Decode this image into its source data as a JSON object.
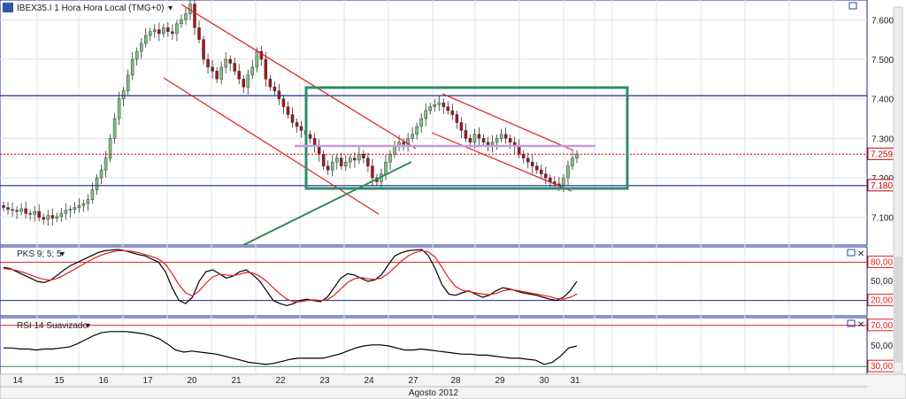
{
  "header": {
    "title": "IBEX35.I 1 Hora Hora Local (TMG+0)"
  },
  "colors": {
    "up_candle": "#7fc47f",
    "down_candle": "#b0101a",
    "channel": "#e02020",
    "support": "#2e8b57",
    "box": "#2e8b6e",
    "hline_blue": "#1c2a8c",
    "resistance": "#c49bdf",
    "price_dotted": "#c00000",
    "osc_black": "#000000",
    "osc_red": "#e02020"
  },
  "chart_data": [
    {
      "type": "candlestick",
      "name_label": "IBEX35.I",
      "ylim": [
        7030,
        7650
      ],
      "yticks": [
        "7.600,0",
        "7.500,0",
        "7.400,0",
        "7.300,0",
        "7.200,0",
        "7.100,0"
      ],
      "ytick_values": [
        7600,
        7500,
        7400,
        7300,
        7200,
        7100
      ],
      "price_labels": [
        {
          "text": "7.259,9",
          "value": 7259.9
        },
        {
          "text": "7.180,4",
          "value": 7180.4
        }
      ],
      "hlines": [
        7408,
        7180.4
      ],
      "dotted_price": 7259.9,
      "closes": [
        7125,
        7120,
        7118,
        7115,
        7122,
        7110,
        7108,
        7115,
        7100,
        7095,
        7105,
        7098,
        7102,
        7110,
        7118,
        7120,
        7125,
        7130,
        7135,
        7145,
        7170,
        7200,
        7220,
        7250,
        7300,
        7350,
        7400,
        7420,
        7460,
        7500,
        7520,
        7540,
        7560,
        7570,
        7575,
        7565,
        7580,
        7570,
        7565,
        7590,
        7600,
        7615,
        7640,
        7580,
        7550,
        7500,
        7480,
        7470,
        7450,
        7480,
        7500,
        7490,
        7470,
        7450,
        7430,
        7460,
        7480,
        7520,
        7500,
        7450,
        7430,
        7420,
        7400,
        7380,
        7360,
        7340,
        7330,
        7320,
        7310,
        7300,
        7280,
        7260,
        7230,
        7220,
        7240,
        7250,
        7230,
        7240,
        7250,
        7245,
        7260,
        7250,
        7230,
        7200,
        7190,
        7210,
        7240,
        7260,
        7280,
        7290,
        7285,
        7300,
        7310,
        7330,
        7350,
        7370,
        7380,
        7385,
        7390,
        7380,
        7370,
        7360,
        7340,
        7320,
        7300,
        7290,
        7310,
        7300,
        7290,
        7280,
        7290,
        7300,
        7310,
        7300,
        7290,
        7280,
        7260,
        7250,
        7240,
        7230,
        7220,
        7210,
        7200,
        7190,
        7185,
        7180,
        7200,
        7230,
        7250,
        7260
      ],
      "axis_color": "#1c2a8c"
    },
    {
      "type": "line",
      "name_label": "PKS 9; 5; 5",
      "ylim": [
        0,
        100
      ],
      "levels": [
        80,
        20
      ],
      "tick_labels": [
        "80,00",
        "50,00",
        "20,00"
      ],
      "tick_values": [
        80,
        50,
        20
      ],
      "series": [
        {
          "values": [
            72,
            70,
            65,
            60,
            55,
            50,
            48,
            52,
            60,
            68,
            75,
            80,
            85,
            90,
            95,
            98,
            99,
            100,
            98,
            95,
            92,
            90,
            85,
            80,
            65,
            40,
            20,
            15,
            25,
            50,
            65,
            68,
            62,
            55,
            58,
            65,
            68,
            60,
            50,
            35,
            20,
            15,
            12,
            15,
            20,
            22,
            20,
            18,
            25,
            40,
            55,
            62,
            60,
            55,
            50,
            52,
            60,
            75,
            90,
            95,
            98,
            99,
            100,
            90,
            70,
            45,
            30,
            28,
            32,
            35,
            30,
            25,
            28,
            35,
            40,
            38,
            35,
            32,
            30,
            28,
            25,
            22,
            20,
            25,
            35,
            50
          ]
        },
        {
          "values": [
            70,
            69,
            67,
            64,
            60,
            56,
            53,
            52,
            55,
            60,
            66,
            72,
            78,
            84,
            89,
            93,
            96,
            98,
            98,
            97,
            95,
            92,
            89,
            85,
            77,
            62,
            45,
            32,
            27,
            35,
            47,
            57,
            61,
            60,
            59,
            61,
            64,
            63,
            58,
            50,
            40,
            30,
            22,
            18,
            18,
            20,
            21,
            20,
            21,
            28,
            38,
            48,
            54,
            56,
            54,
            53,
            55,
            62,
            72,
            82,
            90,
            95,
            98,
            96,
            88,
            72,
            55,
            42,
            36,
            34,
            32,
            30,
            29,
            31,
            35,
            37,
            36,
            34,
            32,
            30,
            28,
            26,
            23,
            22,
            25,
            30
          ]
        }
      ]
    },
    {
      "type": "line",
      "name_label": "RSI 14 Suavizado",
      "ylim": [
        25,
        75
      ],
      "levels": [
        70,
        30
      ],
      "tick_labels": [
        "70,00",
        "50,00",
        "30,00"
      ],
      "tick_values": [
        70,
        50,
        30
      ],
      "series": [
        {
          "values": [
            48,
            48,
            47,
            47,
            46,
            47,
            47,
            48,
            49,
            52,
            56,
            60,
            63,
            64,
            64,
            64,
            63,
            62,
            60,
            57,
            52,
            46,
            44,
            45,
            44,
            43,
            42,
            40,
            38,
            36,
            34,
            33,
            32,
            33,
            35,
            37,
            38,
            38,
            38,
            38,
            40,
            42,
            45,
            48,
            50,
            51,
            51,
            50,
            48,
            46,
            46,
            47,
            46,
            45,
            44,
            43,
            42,
            42,
            41,
            41,
            40,
            39,
            38,
            38,
            37,
            36,
            32,
            34,
            40,
            48,
            50
          ]
        }
      ]
    }
  ],
  "xaxis": {
    "labels": [
      "14",
      "15",
      "16",
      "17",
      "20",
      "21",
      "22",
      "23",
      "24",
      "27",
      "28",
      "29",
      "30",
      "31"
    ],
    "month_label": "Agosto 2012"
  }
}
